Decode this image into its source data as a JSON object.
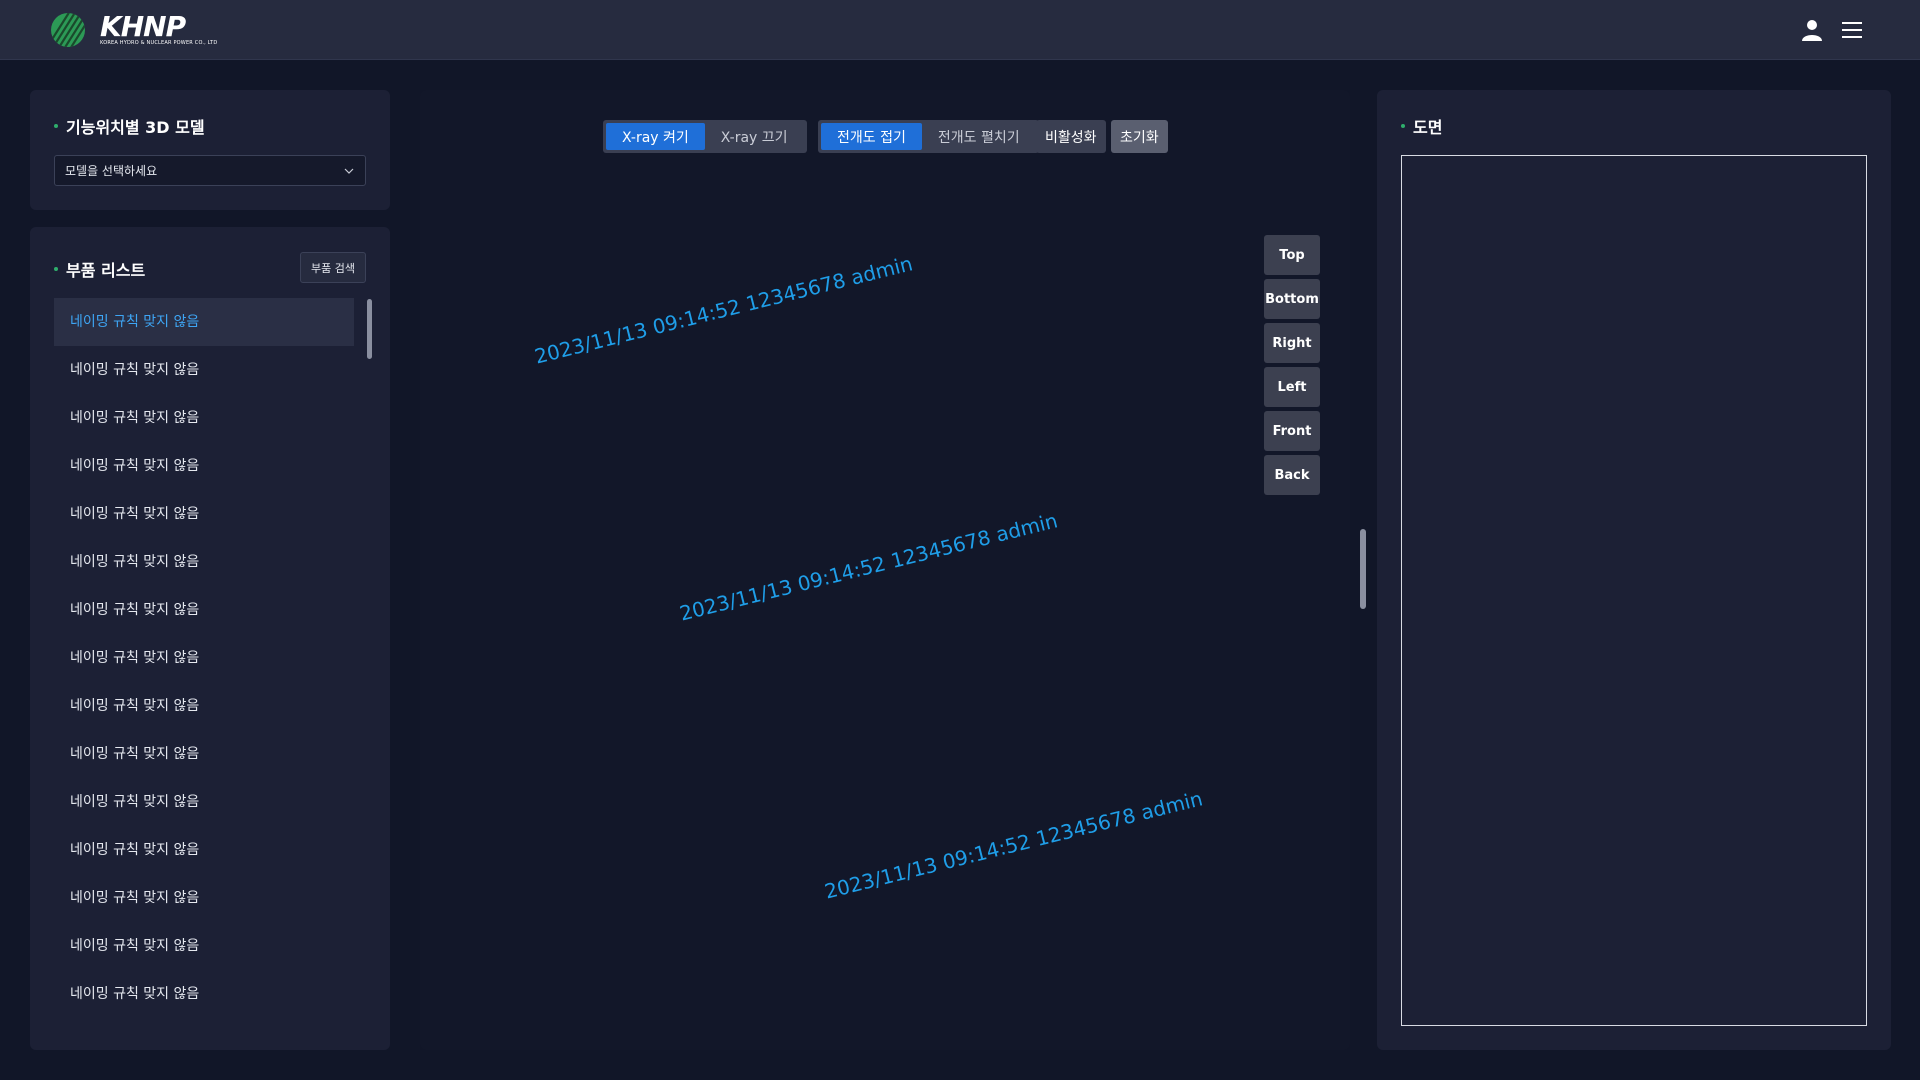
{
  "header": {
    "logo_text": "KHNP",
    "logo_subtitle": "KOREA HYDRO & NUCLEAR POWER CO., LTD",
    "icons": [
      "user-icon",
      "hamburger-menu-icon"
    ]
  },
  "model_panel": {
    "title": "기능위치별 3D 모델",
    "select_value": "모델을 선택하세요"
  },
  "parts_panel": {
    "title": "부품 리스트",
    "search_label": "부품 검색",
    "items": [
      "네이밍 규칙 맞지 않음",
      "네이밍 규칙 맞지 않음",
      "네이밍 규칙 맞지 않음",
      "네이밍 규칙 맞지 않음",
      "네이밍 규칙 맞지 않음",
      "네이밍 규칙 맞지 않음",
      "네이밍 규칙 맞지 않음",
      "네이밍 규칙 맞지 않음",
      "네이밍 규칙 맞지 않음",
      "네이밍 규칙 맞지 않음",
      "네이밍 규칙 맞지 않음",
      "네이밍 규칙 맞지 않음",
      "네이밍 규칙 맞지 않음",
      "네이밍 규칙 맞지 않음",
      "네이밍 규칙 맞지 않음"
    ],
    "selected_index": 0
  },
  "viewer": {
    "toolbar": {
      "xray_on": "X-ray 켜기",
      "xray_off": "X-ray 끄기",
      "fold": "전개도 접기",
      "unfold": "전개도 펼치기",
      "deactivate": "비활성화",
      "reset": "초기화"
    },
    "view_buttons": [
      "Top",
      "Bottom",
      "Right",
      "Left",
      "Front",
      "Back"
    ],
    "watermark": "2023/11/13 09:14:52 12345678 admin"
  },
  "drawing_panel": {
    "title": "도면"
  },
  "colors": {
    "background": "#111628",
    "panel": "#1c2035",
    "accent_blue": "#1f6fd8",
    "watermark": "#1f9ee8",
    "selected_text": "#3ea6f5",
    "bullet_green": "#2fae6c"
  }
}
